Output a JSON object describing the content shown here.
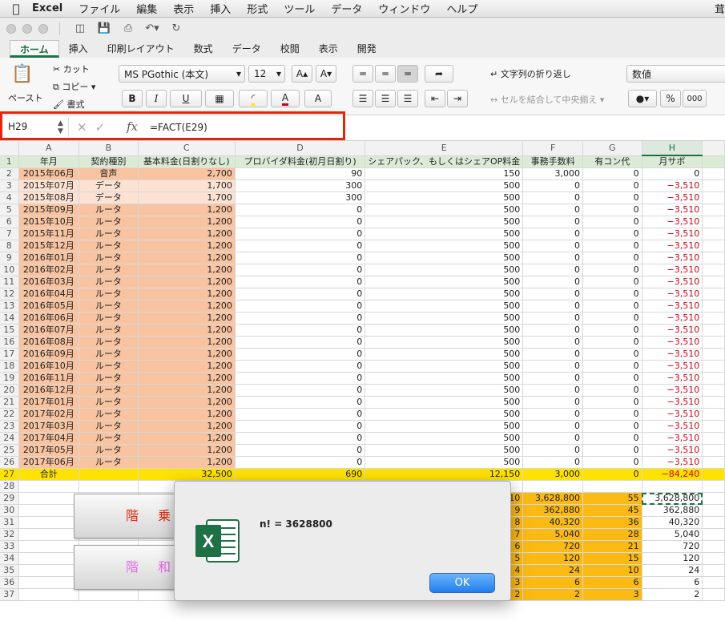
{
  "menubar": {
    "app": "Excel",
    "items": [
      "ファイル",
      "編集",
      "表示",
      "挿入",
      "形式",
      "ツール",
      "データ",
      "ウィンドウ",
      "ヘルプ"
    ],
    "right": "茸"
  },
  "tabs": [
    "ホーム",
    "挿入",
    "印刷レイアウト",
    "数式",
    "データ",
    "校閲",
    "表示",
    "開発"
  ],
  "ribbon": {
    "paste": "ペースト",
    "cut": "カット",
    "copy": "コピー",
    "format_painter": "書式",
    "font_name": "MS PGothic (本文)",
    "font_size": "12",
    "bold": "B",
    "italic": "I",
    "underline": "U",
    "wrap_text": "文字列の折り返し",
    "merge_center": "セルを結合して中央揃え",
    "number_format": "数値",
    "percent": "%",
    "comma": "000"
  },
  "formula_bar": {
    "name_box": "H29",
    "fx": "fx",
    "formula": "=FACT(E29)"
  },
  "columns": [
    "A",
    "B",
    "C",
    "D",
    "E",
    "F",
    "G",
    "H"
  ],
  "header_row": [
    "年月",
    "契約種別",
    "基本料金(日割りなし)",
    "プロバイダ料金(初月日割り)",
    "シェアパック、もしくはシェアOP料金",
    "事務手数料",
    "有コン代",
    "月サポ"
  ],
  "rows": [
    [
      "2015年06月",
      "音声",
      "2,700",
      "90",
      "150",
      "3,000",
      "0",
      "0"
    ],
    [
      "2015年07月",
      "データ",
      "1,700",
      "300",
      "500",
      "0",
      "0",
      "−3,510"
    ],
    [
      "2015年08月",
      "データ",
      "1,700",
      "300",
      "500",
      "0",
      "0",
      "−3,510"
    ],
    [
      "2015年09月",
      "ルータ",
      "1,200",
      "0",
      "500",
      "0",
      "0",
      "−3,510"
    ],
    [
      "2015年10月",
      "ルータ",
      "1,200",
      "0",
      "500",
      "0",
      "0",
      "−3,510"
    ],
    [
      "2015年11月",
      "ルータ",
      "1,200",
      "0",
      "500",
      "0",
      "0",
      "−3,510"
    ],
    [
      "2015年12月",
      "ルータ",
      "1,200",
      "0",
      "500",
      "0",
      "0",
      "−3,510"
    ],
    [
      "2016年01月",
      "ルータ",
      "1,200",
      "0",
      "500",
      "0",
      "0",
      "−3,510"
    ],
    [
      "2016年02月",
      "ルータ",
      "1,200",
      "0",
      "500",
      "0",
      "0",
      "−3,510"
    ],
    [
      "2016年03月",
      "ルータ",
      "1,200",
      "0",
      "500",
      "0",
      "0",
      "−3,510"
    ],
    [
      "2016年04月",
      "ルータ",
      "1,200",
      "0",
      "500",
      "0",
      "0",
      "−3,510"
    ],
    [
      "2016年05月",
      "ルータ",
      "1,200",
      "0",
      "500",
      "0",
      "0",
      "−3,510"
    ],
    [
      "2016年06月",
      "ルータ",
      "1,200",
      "0",
      "500",
      "0",
      "0",
      "−3,510"
    ],
    [
      "2016年07月",
      "ルータ",
      "1,200",
      "0",
      "500",
      "0",
      "0",
      "−3,510"
    ],
    [
      "2016年08月",
      "ルータ",
      "1,200",
      "0",
      "500",
      "0",
      "0",
      "−3,510"
    ],
    [
      "2016年09月",
      "ルータ",
      "1,200",
      "0",
      "500",
      "0",
      "0",
      "−3,510"
    ],
    [
      "2016年10月",
      "ルータ",
      "1,200",
      "0",
      "500",
      "0",
      "0",
      "−3,510"
    ],
    [
      "2016年11月",
      "ルータ",
      "1,200",
      "0",
      "500",
      "0",
      "0",
      "−3,510"
    ],
    [
      "2016年12月",
      "ルータ",
      "1,200",
      "0",
      "500",
      "0",
      "0",
      "−3,510"
    ],
    [
      "2017年01月",
      "ルータ",
      "1,200",
      "0",
      "500",
      "0",
      "0",
      "−3,510"
    ],
    [
      "2017年02月",
      "ルータ",
      "1,200",
      "0",
      "500",
      "0",
      "0",
      "−3,510"
    ],
    [
      "2017年03月",
      "ルータ",
      "1,200",
      "0",
      "500",
      "0",
      "0",
      "−3,510"
    ],
    [
      "2017年04月",
      "ルータ",
      "1,200",
      "0",
      "500",
      "0",
      "0",
      "−3,510"
    ],
    [
      "2017年05月",
      "ルータ",
      "1,200",
      "0",
      "500",
      "0",
      "0",
      "−3,510"
    ],
    [
      "2017年06月",
      "ルータ",
      "1,200",
      "0",
      "500",
      "0",
      "0",
      "−3,510"
    ]
  ],
  "total_row": [
    "合計",
    "",
    "32,500",
    "690",
    "12,150",
    "3,000",
    "0",
    "−84,240"
  ],
  "lower_rows": [
    [
      "10",
      "3,628,800",
      "55",
      "3,628,800"
    ],
    [
      "9",
      "362,880",
      "45",
      "362,880"
    ],
    [
      "8",
      "40,320",
      "36",
      "40,320"
    ],
    [
      "7",
      "5,040",
      "28",
      "5,040"
    ],
    [
      "6",
      "720",
      "21",
      "720"
    ],
    [
      "5",
      "120",
      "15",
      "120"
    ],
    [
      "4",
      "24",
      "10",
      "24"
    ],
    [
      "3",
      "6",
      "6",
      "6"
    ],
    [
      "2",
      "2",
      "3",
      "2"
    ]
  ],
  "shapes": {
    "factorial_button": "階乗",
    "sum_button": "階和"
  },
  "dialog": {
    "message": "n! = 3628800",
    "ok": "OK"
  }
}
